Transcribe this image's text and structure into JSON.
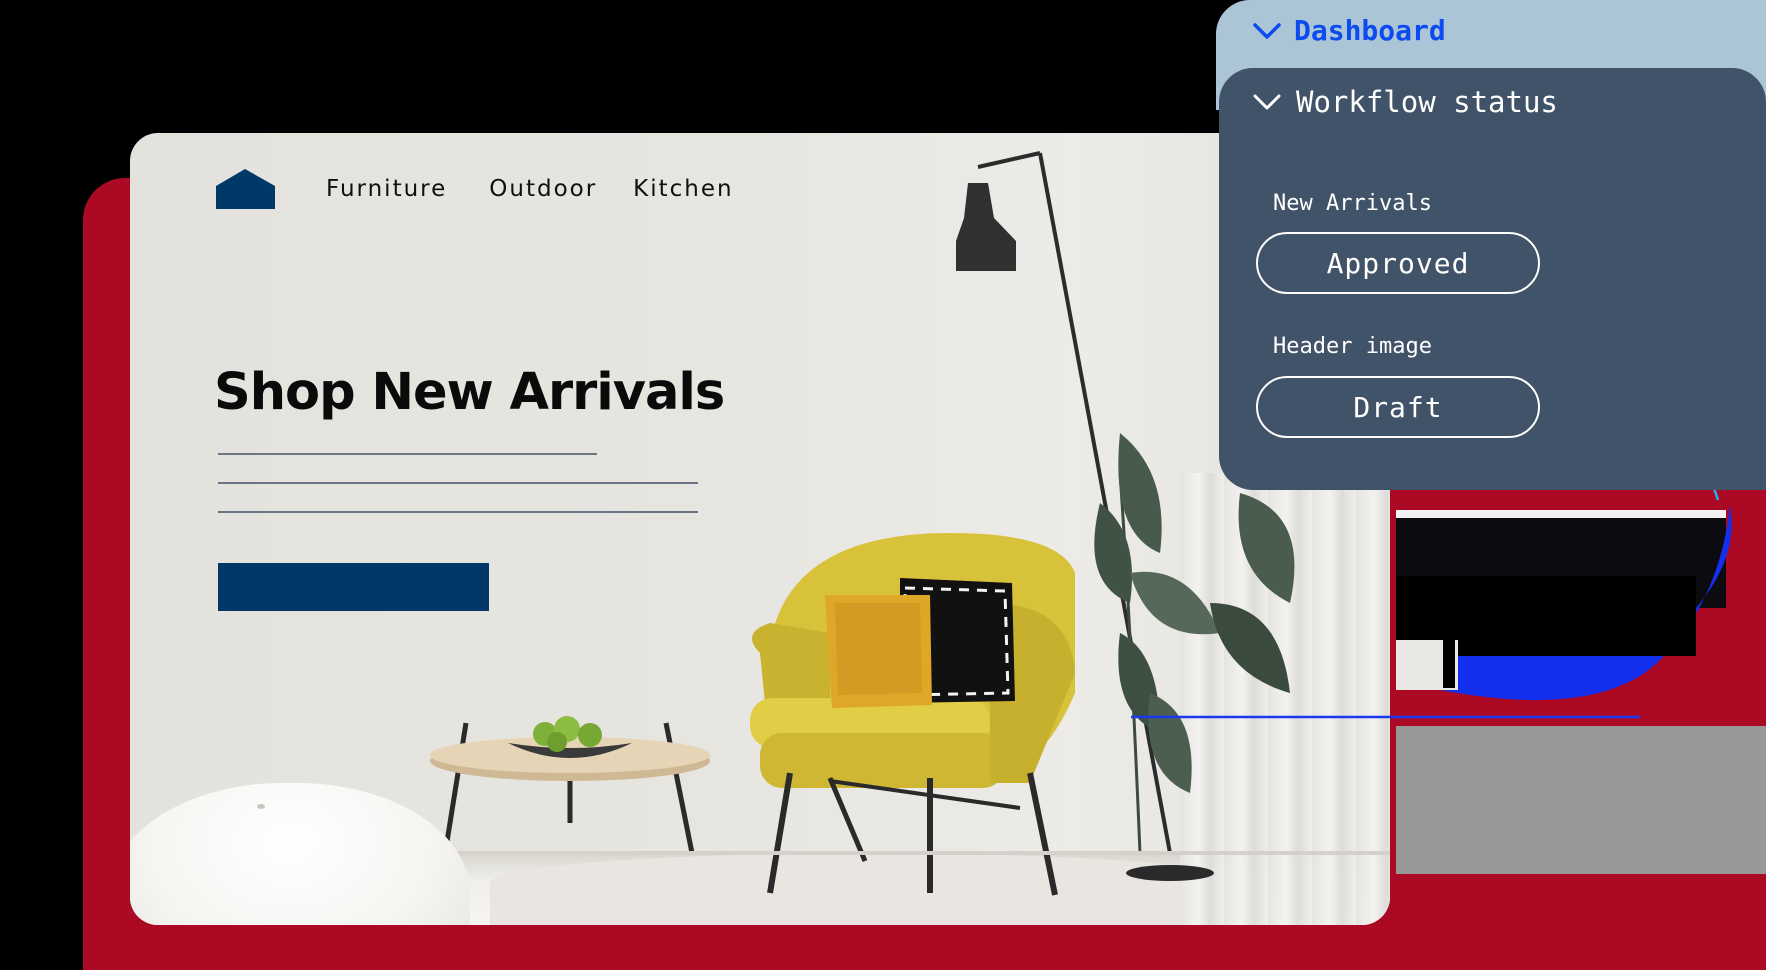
{
  "site": {
    "nav": {
      "home_icon": "home-icon",
      "links": [
        "Furniture",
        "Outdoor",
        "Kitchen"
      ]
    },
    "hero": {
      "title": "Shop New Arrivals"
    }
  },
  "workflow": {
    "dashboard_label": "Dashboard",
    "panel_title": "Workflow status",
    "items": [
      {
        "label": "New Arrivals",
        "status": "Approved"
      },
      {
        "label": "Header image",
        "status": "Draft"
      }
    ]
  },
  "colors": {
    "brand_navy": "#003868",
    "backdrop_red": "#ac0a24",
    "panel_slate": "#415368",
    "dashboard_bar": "#abc5d6",
    "dashboard_text": "#0b4bef",
    "connector_cyan": "#1ab4e6",
    "connector_blue": "#1a38f0",
    "chair_yellow": "#d9c43a"
  }
}
